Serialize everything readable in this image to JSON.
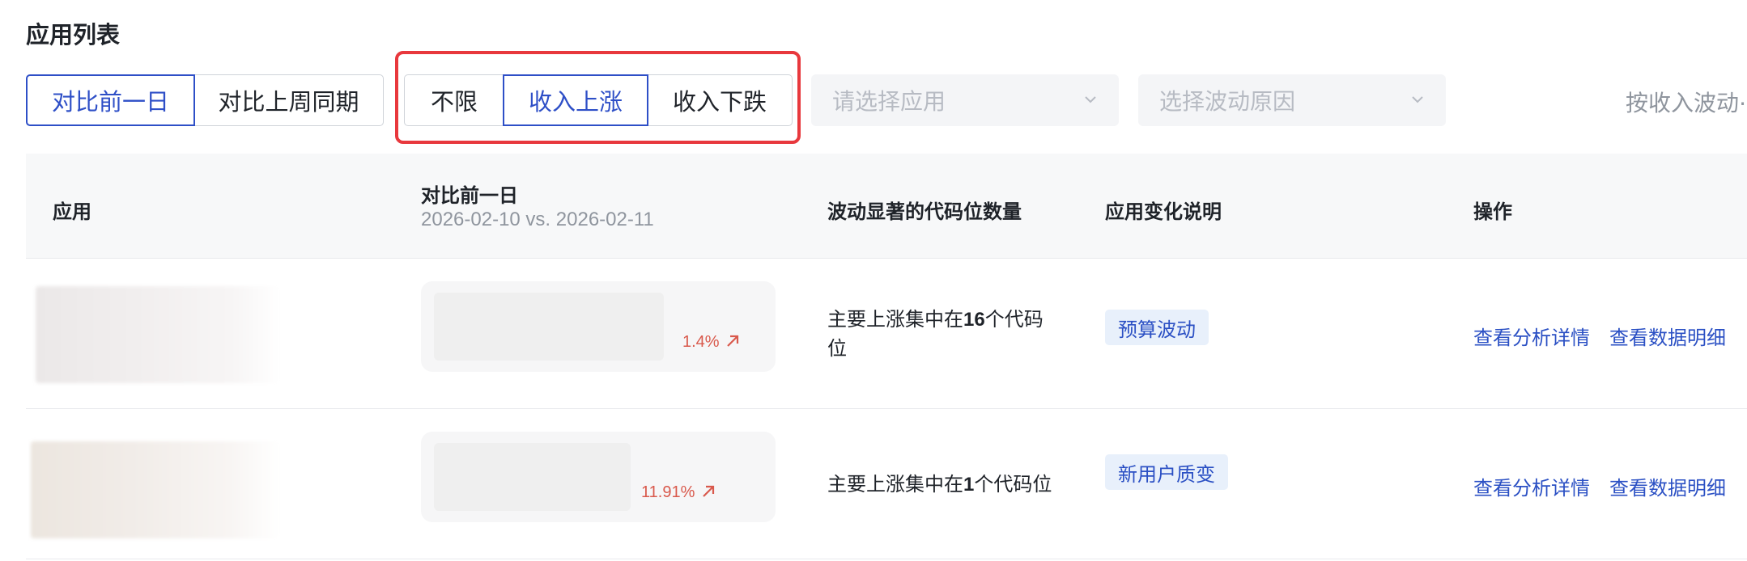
{
  "section_title": "应用列表",
  "compare": {
    "day": "对比前一日",
    "week": "对比上周同期",
    "active": "day"
  },
  "filter": {
    "all": "不限",
    "up": "收入上涨",
    "down": "收入下跌",
    "active": "up"
  },
  "selects": {
    "app_placeholder": "请选择应用",
    "reason_placeholder": "选择波动原因"
  },
  "sort_label": "按收入波动⋯",
  "table": {
    "headers": {
      "app": "应用",
      "compare_title": "对比前一日",
      "compare_dates": "2026-02-10 vs. 2026-02-11",
      "slots": "波动显著的代码位数量",
      "change": "应用变化说明",
      "action": "操作"
    },
    "rows": [
      {
        "pct": "1.4%",
        "desc_prefix": "主要上涨集中在",
        "desc_num": "16",
        "desc_suffix": "个代码位",
        "tag": "预算波动",
        "action_detail": "查看分析详情",
        "action_data": "查看数据明细"
      },
      {
        "pct": "11.91%",
        "desc_prefix": "主要上涨集中在",
        "desc_num": "1",
        "desc_suffix": "个代码位",
        "tag": "新用户质变",
        "action_detail": "查看分析详情",
        "action_data": "查看数据明细"
      }
    ]
  },
  "colors": {
    "accent": "#2e4fc7",
    "highlight_box": "#e8383d",
    "rise": "#d9594c",
    "tag_bg": "#e8f0fb"
  },
  "icons": {
    "select_chevron": "chevron-down-icon",
    "rise_arrow": "arrow-up-right-icon"
  }
}
